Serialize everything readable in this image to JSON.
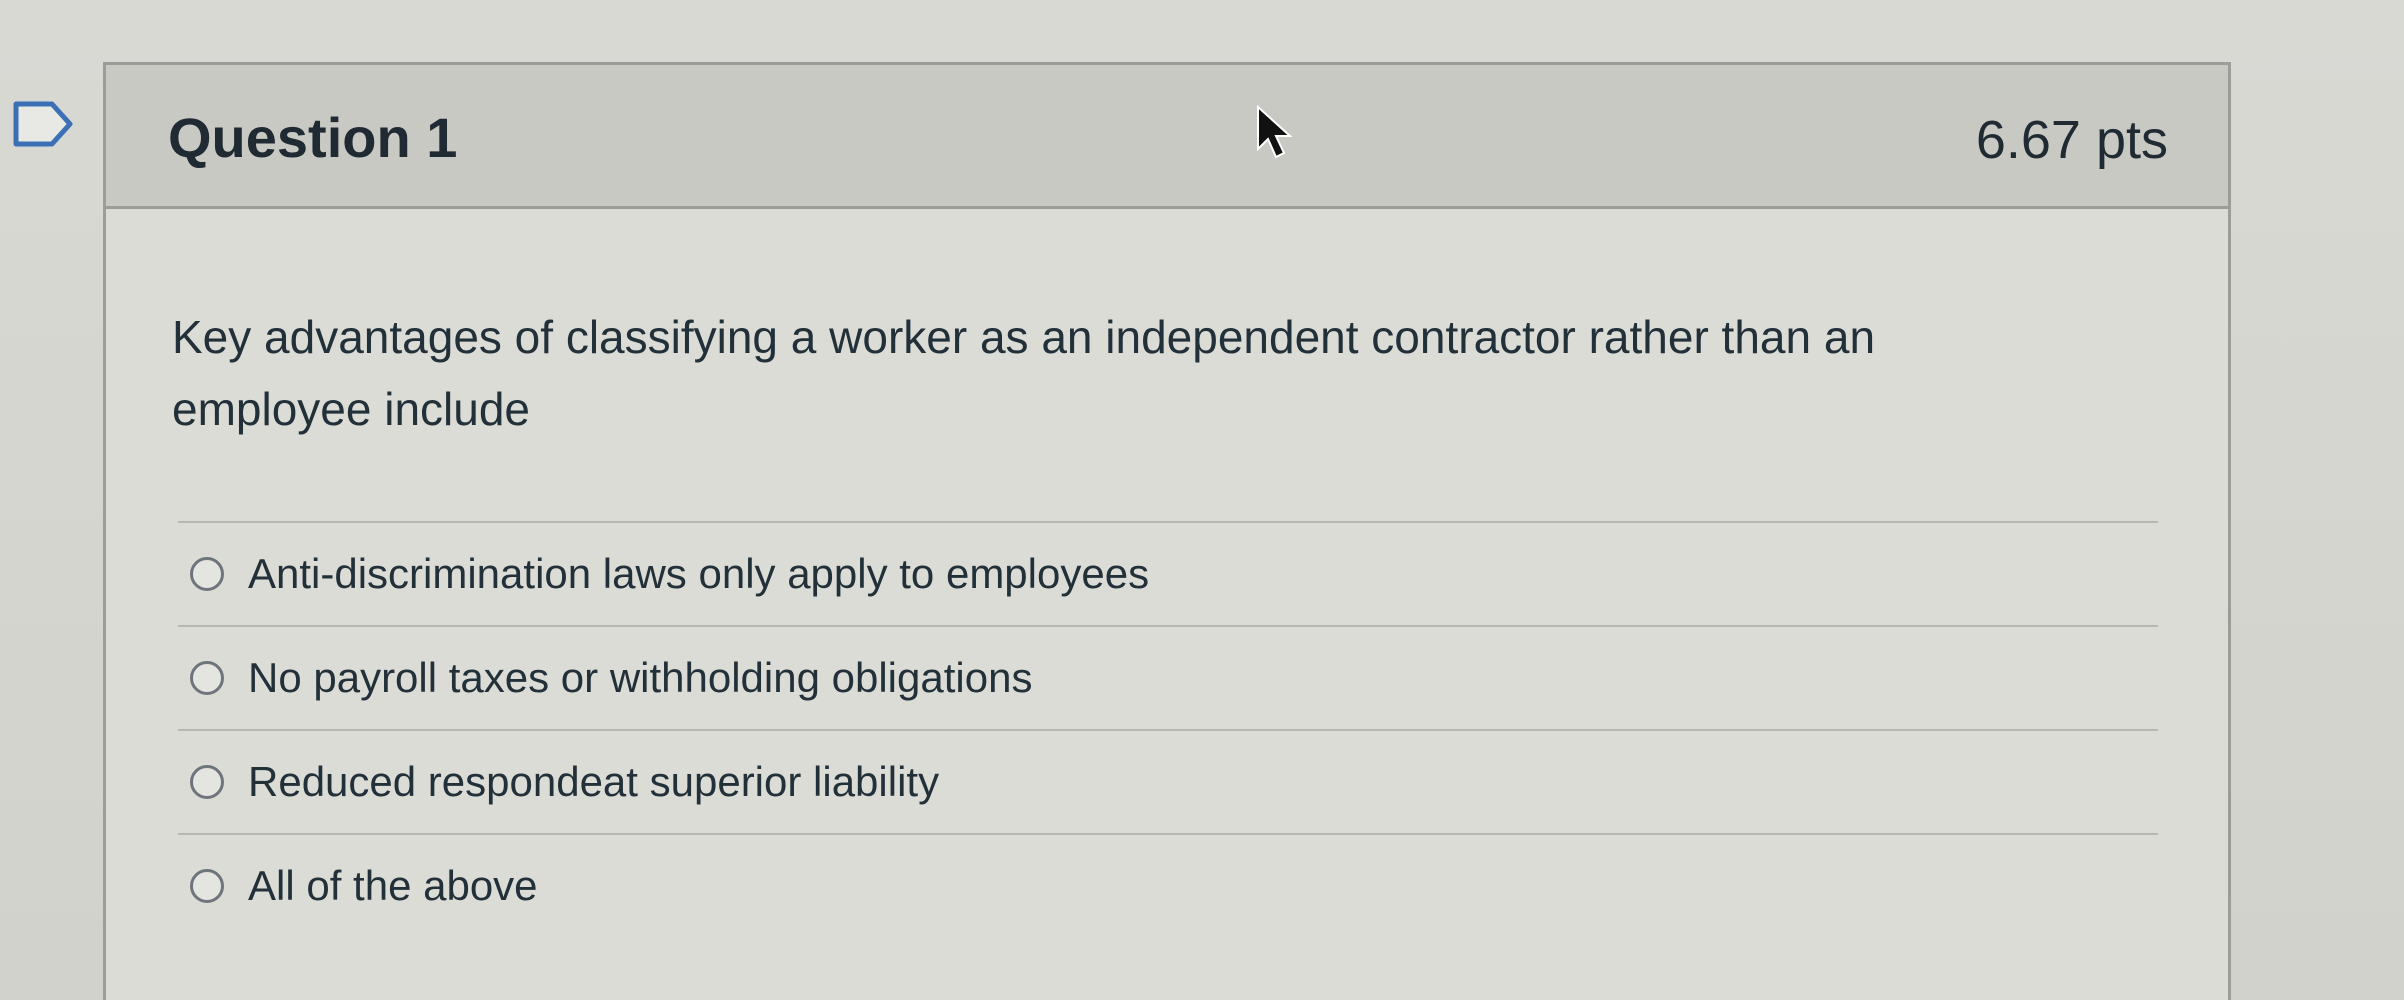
{
  "question": {
    "title": "Question 1",
    "points": "6.67 pts",
    "text": "Key advantages of classifying a worker as an independent contractor rather than an employee include"
  },
  "answers": [
    {
      "label": "Anti-discrimination laws only apply to employees"
    },
    {
      "label": "No payroll taxes or withholding obligations"
    },
    {
      "label": "Reduced respondeat superior liability"
    },
    {
      "label": "All of the above"
    }
  ],
  "icons": {
    "flag": "flag-question-icon",
    "cursor": "mouse-pointer-icon",
    "radio": "radio-unselected-icon"
  }
}
